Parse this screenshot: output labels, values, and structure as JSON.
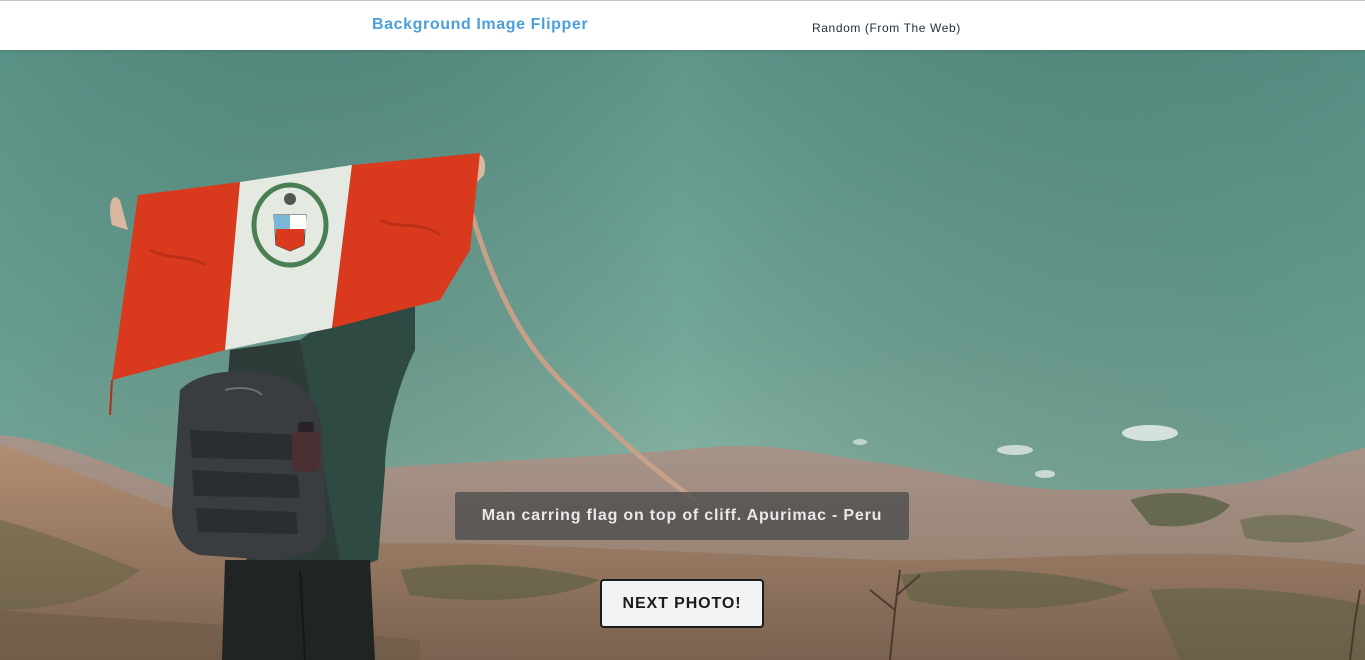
{
  "navbar": {
    "brand": "Background Image Flipper",
    "link": "Random (From The Web)"
  },
  "photo": {
    "caption": "Man carring flag on top of cliff. Apurimac - Peru"
  },
  "actions": {
    "next_label": "NEXT PHOTO!"
  },
  "colors": {
    "brand": "#4a9fdc",
    "nav_text": "#1f2d3d",
    "sky": "#6fa89a",
    "flag_red": "#d93a1e",
    "flag_white": "#e4e9e2"
  }
}
